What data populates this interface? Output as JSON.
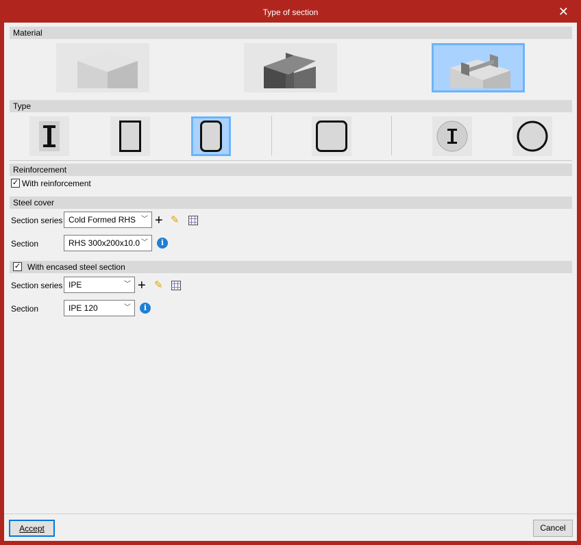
{
  "window": {
    "title": "Type of section",
    "close_icon": "close-icon"
  },
  "material": {
    "header": "Material",
    "options": [
      {
        "name": "concrete",
        "selected": false
      },
      {
        "name": "steel",
        "selected": false
      },
      {
        "name": "composite",
        "selected": true
      }
    ]
  },
  "type": {
    "header": "Type",
    "options": [
      {
        "name": "concrete-encased-i",
        "selected": false
      },
      {
        "name": "rectangular-steel-tube-filled",
        "selected": false
      },
      {
        "name": "rounded-rectangular-filled",
        "selected": true
      },
      {
        "name": "square-filled",
        "selected": false
      },
      {
        "name": "circular-encased-i",
        "selected": false
      },
      {
        "name": "circular-filled",
        "selected": false
      }
    ]
  },
  "reinforcement": {
    "header": "Reinforcement",
    "checkbox_label": "With reinforcement",
    "checked": true
  },
  "steel_cover": {
    "header": "Steel cover",
    "series_label": "Section series",
    "series_value": "Cold Formed RHS",
    "section_label": "Section",
    "section_value": "RHS 300x200x10.0"
  },
  "encased": {
    "checkbox_label": "With encased steel section",
    "checked": true,
    "series_label": "Section series",
    "series_value": "IPE",
    "section_label": "Section",
    "section_value": "IPE 120"
  },
  "footer": {
    "accept": "Accept",
    "cancel": "Cancel"
  }
}
